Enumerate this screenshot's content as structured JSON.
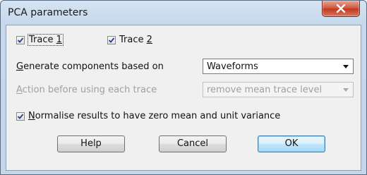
{
  "window": {
    "title": "PCA parameters"
  },
  "options": {
    "trace1": {
      "prefix": "Trace ",
      "mnemonic": "1",
      "checked": true
    },
    "trace2": {
      "prefix": "Trace ",
      "mnemonic": "2",
      "checked": true
    },
    "normalise": {
      "mnemonic": "N",
      "rest": "ormalise results to have zero mean and unit variance",
      "checked": true
    }
  },
  "components": {
    "label_mnemonic": "G",
    "label_rest": "enerate components based on",
    "selected": "Waveforms"
  },
  "action": {
    "label_mnemonic": "A",
    "label_rest": "ction before using each trace",
    "selected": "remove mean trace level",
    "disabled": true
  },
  "buttons": {
    "help": "Help",
    "cancel": "Cancel",
    "ok": "OK"
  },
  "colors": {
    "titlebar": "#c6d8ec",
    "close_button": "#c2371f",
    "dialog_face": "#f0f0f0",
    "disabled_text": "#a0a0a0",
    "default_button": "#bee6fd"
  },
  "icons": {
    "close": "close-icon",
    "check": "checkmark-icon",
    "dropdown": "chevron-down-icon"
  }
}
